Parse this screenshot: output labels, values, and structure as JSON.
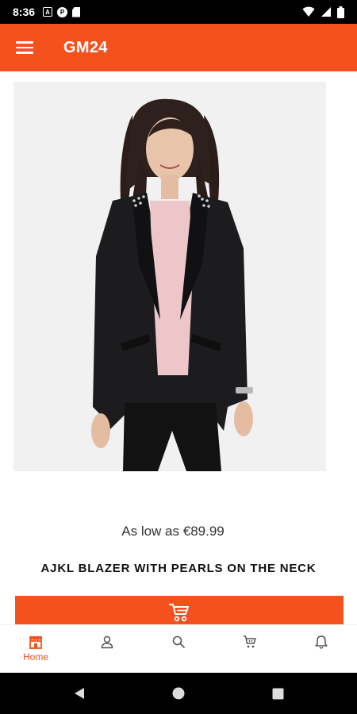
{
  "status_bar": {
    "time": "8:36",
    "left_icons": [
      "a-badge-icon",
      "p-circle-icon",
      "sd-card-icon"
    ],
    "right_icons": [
      "wifi-icon",
      "signal-icon",
      "battery-icon"
    ]
  },
  "app_bar": {
    "title": "GM24",
    "menu_icon": "hamburger-menu-icon"
  },
  "product": {
    "image_alt": "Woman wearing black blazer",
    "price": "As low as €89.99",
    "name": "AJKL BLAZER WITH PEARLS ON THE NECK",
    "cart_icon": "cart-icon"
  },
  "bottom_nav": {
    "items": [
      {
        "label": "Home",
        "icon": "store-icon",
        "active": true
      },
      {
        "label": "",
        "icon": "user-icon",
        "active": false
      },
      {
        "label": "",
        "icon": "search-icon",
        "active": false
      },
      {
        "label": "",
        "icon": "cart-icon",
        "active": false
      },
      {
        "label": "",
        "icon": "bell-icon",
        "active": false
      }
    ]
  },
  "colors": {
    "accent": "#f4511e",
    "icon_gray": "#555555"
  }
}
